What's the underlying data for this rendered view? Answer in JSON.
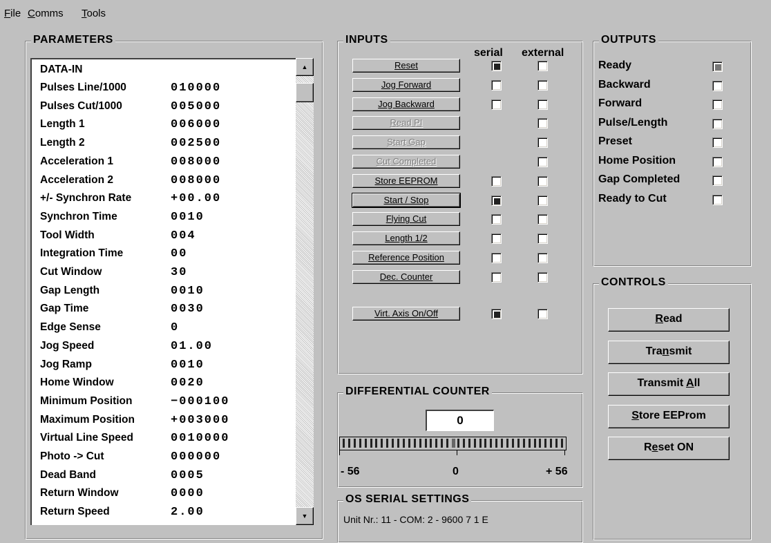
{
  "menu": {
    "items": [
      {
        "label": "File",
        "ul": "F",
        "rest": "ile"
      },
      {
        "label": "Comms",
        "ul": "C",
        "rest": "omms"
      },
      {
        "label": "Tools",
        "ul": "T",
        "rest": "ools"
      }
    ]
  },
  "parameters": {
    "title": "PARAMETERS",
    "header": "DATA-IN",
    "rows": [
      {
        "name": "Pulses Line/1000",
        "value": "010000"
      },
      {
        "name": "Pulses Cut/1000",
        "value": "005000"
      },
      {
        "name": "Length 1",
        "value": "006000"
      },
      {
        "name": "Length 2",
        "value": "002500"
      },
      {
        "name": "Acceleration 1",
        "value": "008000"
      },
      {
        "name": "Acceleration 2",
        "value": "008000"
      },
      {
        "name": "+/- Synchron Rate",
        "value": "+00.00"
      },
      {
        "name": "Synchron Time",
        "value": "0010"
      },
      {
        "name": "Tool Width",
        "value": "004"
      },
      {
        "name": "Integration Time",
        "value": "00"
      },
      {
        "name": "Cut Window",
        "value": "30"
      },
      {
        "name": "Gap Length",
        "value": "0010"
      },
      {
        "name": "Gap Time",
        "value": "0030"
      },
      {
        "name": "Edge Sense",
        "value": "0"
      },
      {
        "name": "Jog Speed",
        "value": "01.00"
      },
      {
        "name": "Jog Ramp",
        "value": "0010"
      },
      {
        "name": "Home Window",
        "value": "0020"
      },
      {
        "name": "Minimum Position",
        "value": "−000100"
      },
      {
        "name": "Maximum Position",
        "value": "+003000"
      },
      {
        "name": "Virtual Line Speed",
        "value": "0010000"
      },
      {
        "name": "Photo -> Cut",
        "value": "000000"
      },
      {
        "name": "Dead Band",
        "value": "0005"
      },
      {
        "name": "Return Window",
        "value": "0000"
      },
      {
        "name": "Return Speed",
        "value": "2.00"
      }
    ]
  },
  "inputs": {
    "title": "INPUTS",
    "col_serial": "serial",
    "col_external": "external",
    "rows": [
      {
        "label": "Reset",
        "enabled": true,
        "serial": "checked",
        "external": "unchecked"
      },
      {
        "label": "Jog Forward",
        "enabled": true,
        "serial": "unchecked",
        "external": "unchecked"
      },
      {
        "label": "Jog Backward",
        "enabled": true,
        "serial": "unchecked",
        "external": "unchecked"
      },
      {
        "label": "Read PI",
        "enabled": false,
        "serial": "none",
        "external": "unchecked"
      },
      {
        "label": "Start Gap",
        "enabled": false,
        "serial": "none",
        "external": "unchecked"
      },
      {
        "label": "Cut Completed",
        "enabled": false,
        "serial": "none",
        "external": "unchecked"
      },
      {
        "label": "Store EEPROM",
        "enabled": true,
        "serial": "unchecked",
        "external": "unchecked"
      },
      {
        "label": "Start / Stop",
        "enabled": true,
        "focused": true,
        "serial": "checked",
        "external": "unchecked"
      },
      {
        "label": "Flying Cut",
        "enabled": true,
        "serial": "unchecked",
        "external": "unchecked"
      },
      {
        "label": "Length 1/2",
        "enabled": true,
        "serial": "unchecked",
        "external": "unchecked"
      },
      {
        "label": "Reference Position",
        "enabled": true,
        "serial": "unchecked",
        "external": "unchecked"
      },
      {
        "label": "Dec. Counter",
        "enabled": true,
        "serial": "unchecked",
        "external": "unchecked"
      }
    ],
    "virt": {
      "label": "Virt. Axis On/Off",
      "serial": "checked",
      "external": "unchecked"
    }
  },
  "outputs": {
    "title": "OUTPUTS",
    "rows": [
      {
        "label": "Ready",
        "state": "checked"
      },
      {
        "label": "Backward",
        "state": "unchecked"
      },
      {
        "label": "Forward",
        "state": "unchecked"
      },
      {
        "label": "Pulse/Length",
        "state": "unchecked"
      },
      {
        "label": "Preset",
        "state": "unchecked"
      },
      {
        "label": "Home Position",
        "state": "unchecked"
      },
      {
        "label": "Gap Completed",
        "state": "unchecked"
      },
      {
        "label": "Ready to Cut",
        "state": "unchecked"
      }
    ]
  },
  "controls": {
    "title": "CONTROLS",
    "buttons": [
      {
        "label": "Read",
        "pre": "",
        "ul": "R",
        "post": "ead"
      },
      {
        "label": "Transmit",
        "pre": "Tra",
        "ul": "n",
        "post": "smit"
      },
      {
        "label": "Transmit All",
        "pre": "Transmit ",
        "ul": "A",
        "post": "ll"
      },
      {
        "label": "Store EEProm",
        "pre": "",
        "ul": "S",
        "post": "tore EEProm"
      },
      {
        "label": "Reset ON",
        "pre": "R",
        "ul": "e",
        "post": "set ON"
      }
    ]
  },
  "differential_counter": {
    "title": "DIFFERENTIAL COUNTER",
    "value": "0",
    "min_label": "- 56",
    "center_label": "0",
    "max_label": "+ 56"
  },
  "serial_settings": {
    "title": "OS SERIAL SETTINGS",
    "text": "Unit Nr.: 11  -  COM:  2  -  9600  7  1  E"
  },
  "colors": {
    "background": "#c0c0c0",
    "checked_fill": "#222222"
  }
}
